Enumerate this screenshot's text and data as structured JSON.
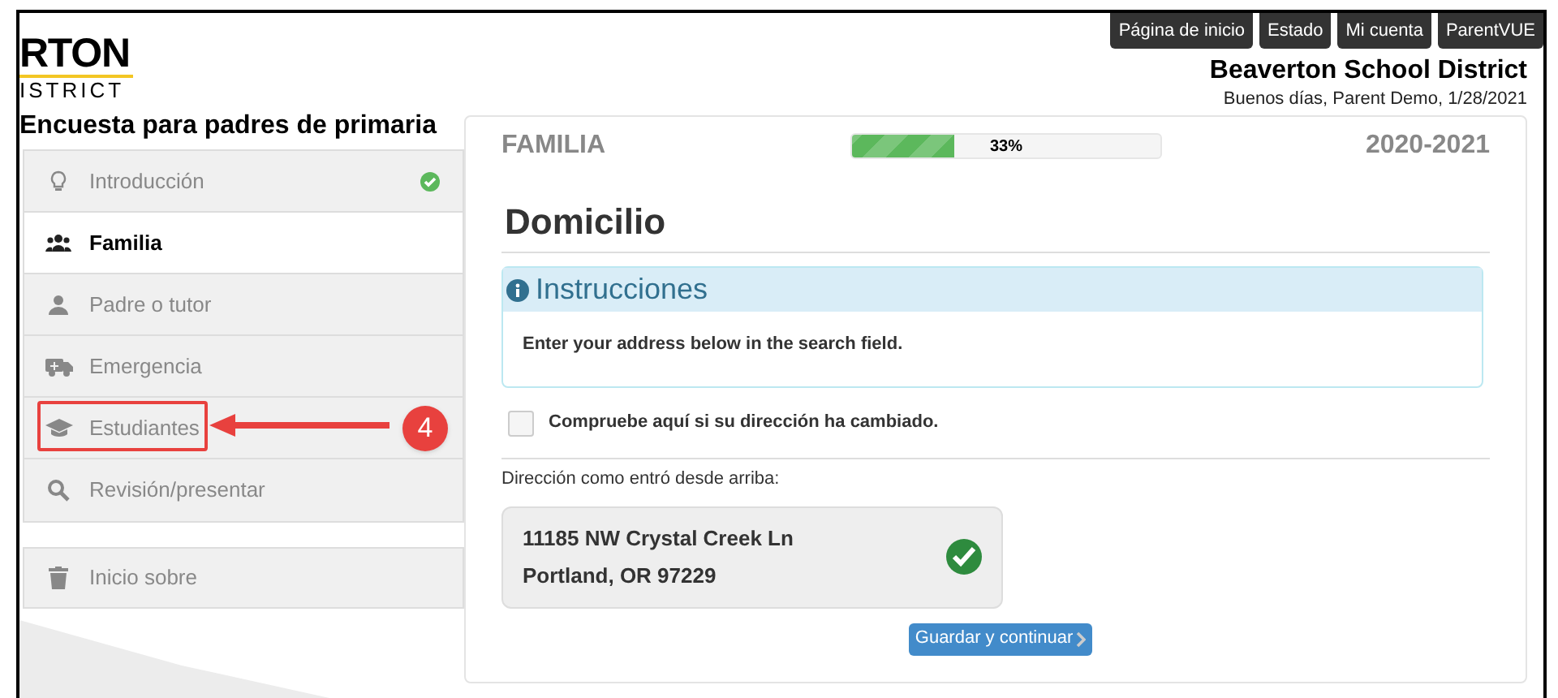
{
  "logo": {
    "line_1": "RTON",
    "line_2": "ISTRICT"
  },
  "top_nav": [
    {
      "label": "Página de inicio"
    },
    {
      "label": "Estado"
    },
    {
      "label": "Mi cuenta"
    },
    {
      "label": "ParentVUE"
    }
  ],
  "header": {
    "district": "Beaverton School District",
    "greeting": "Buenos días, Parent Demo, 1/28/2021"
  },
  "survey_title": "Encuesta para padres de primaria",
  "sidebar": {
    "items": [
      {
        "label": "Introducción",
        "kind": "bulb",
        "selected": false,
        "completed": true,
        "annotated": false
      },
      {
        "label": "Familia",
        "kind": "people",
        "selected": true,
        "completed": false,
        "annotated": false
      },
      {
        "label": "Padre o tutor",
        "kind": "person",
        "selected": false,
        "completed": false,
        "annotated": false
      },
      {
        "label": "Emergencia",
        "kind": "ambulance",
        "selected": false,
        "completed": false,
        "annotated": false
      },
      {
        "label": "Estudiantes",
        "kind": "cap",
        "selected": false,
        "completed": false,
        "annotated": true
      },
      {
        "label": "Revisión/presentar",
        "kind": "search",
        "selected": false,
        "completed": false,
        "annotated": false
      }
    ],
    "footer_items": [
      {
        "label": "Inicio sobre",
        "kind": "trash"
      }
    ]
  },
  "annotation": {
    "step": "4"
  },
  "main": {
    "section": "FAMILIA",
    "progress": {
      "level": 0.33,
      "label": "33%"
    },
    "year": "2020-2021",
    "heading": "Domicilio",
    "instructions": {
      "title": "Instrucciones",
      "text": "Enter your address below in the search field."
    },
    "address_changed": {
      "label": "Compruebe aquí si su dirección ha cambiado.",
      "checked": false
    },
    "address_label": "Dirección como entró desde arriba:",
    "address": {
      "lines": [
        "11185 NW Crystal Creek Ln",
        "Portland, OR 97229"
      ],
      "verified": true
    },
    "button": "Guardar y continuar"
  }
}
